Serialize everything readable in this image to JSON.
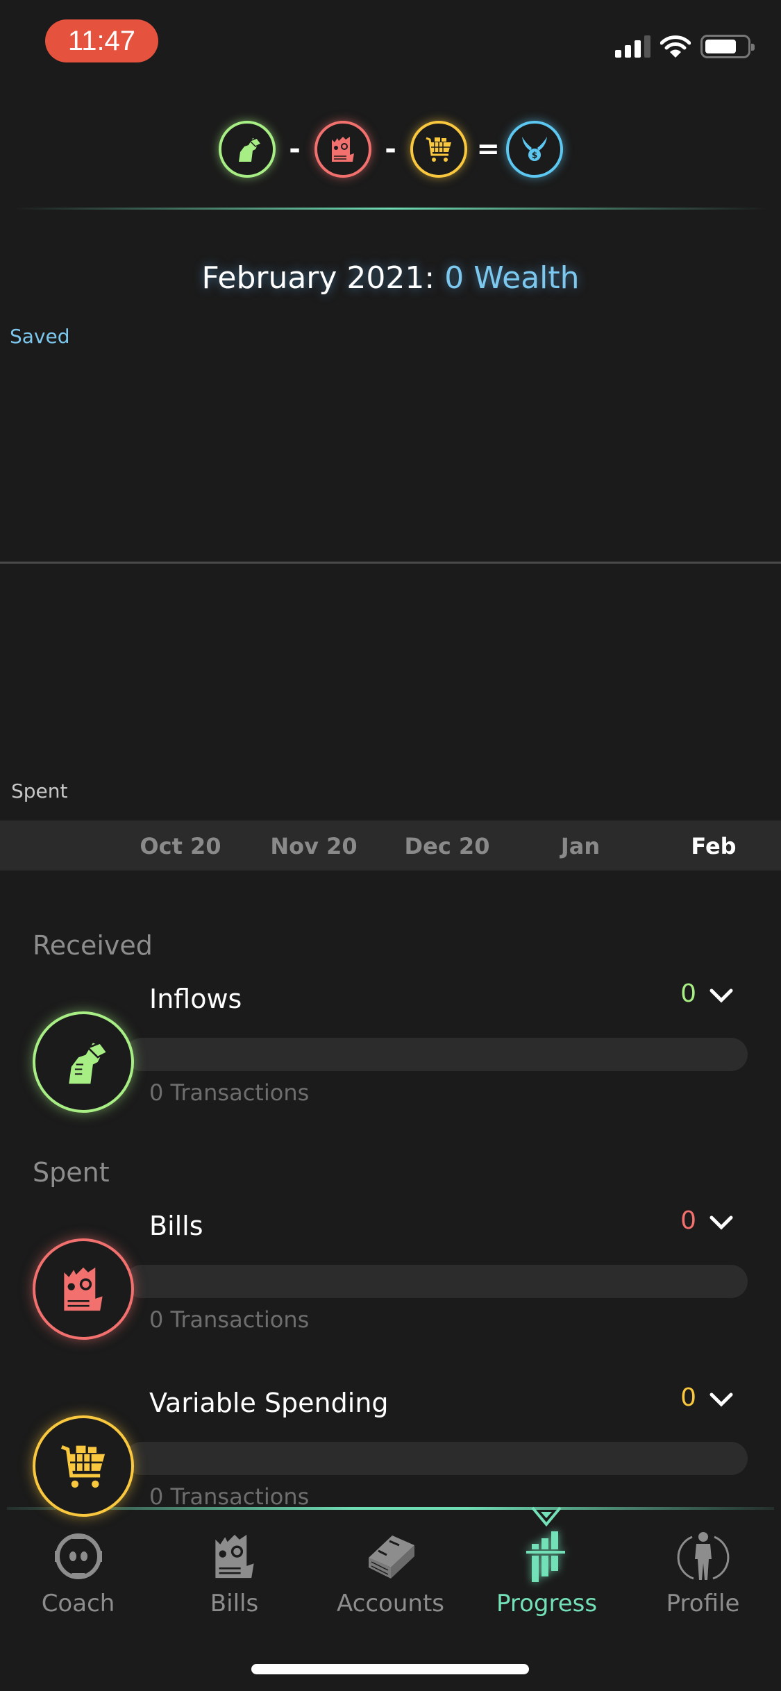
{
  "status_bar": {
    "time": "11:47",
    "signal_bars": 3,
    "signal_bars_total": 4,
    "battery_level": 0.75
  },
  "formula": {
    "items": [
      {
        "name": "inflows",
        "icon": "money-fist-icon",
        "color": "#a7ee84"
      },
      {
        "operator": "-"
      },
      {
        "name": "bills",
        "icon": "bill-receipt-icon",
        "color": "#f2706d"
      },
      {
        "operator": "-"
      },
      {
        "name": "variable-spending",
        "icon": "shopping-cart-icon",
        "color": "#f9c83e"
      },
      {
        "operator": "="
      },
      {
        "name": "wealth",
        "icon": "winged-coin-icon",
        "color": "#5cc8f2"
      }
    ]
  },
  "header": {
    "title_prefix": "February 2021: ",
    "title_value": "0 Wealth"
  },
  "chart": {
    "saved_label": "Saved",
    "spent_label": "Spent"
  },
  "chart_data": {
    "type": "bar",
    "title": "February 2021: 0 Wealth",
    "categories": [
      "Oct 20",
      "Nov 20",
      "Dec 20",
      "Jan",
      "Feb"
    ],
    "series": [
      {
        "name": "Saved",
        "values": [
          0,
          0,
          0,
          0,
          0
        ]
      },
      {
        "name": "Spent",
        "values": [
          0,
          0,
          0,
          0,
          0
        ]
      }
    ],
    "selected": "Feb",
    "xlabel": "",
    "ylabel": ""
  },
  "months": [
    {
      "label": "Oct 20",
      "active": false
    },
    {
      "label": "Nov 20",
      "active": false
    },
    {
      "label": "Dec 20",
      "active": false
    },
    {
      "label": "Jan",
      "active": false
    },
    {
      "label": "Feb",
      "active": true
    }
  ],
  "sections": {
    "received": {
      "header": "Received",
      "items": [
        {
          "name": "Inflows",
          "amount": "0",
          "transactions": "0 Transactions",
          "color": "#a7ee84",
          "progress": 0
        }
      ]
    },
    "spent": {
      "header": "Spent",
      "items": [
        {
          "name": "Bills",
          "amount": "0",
          "transactions": "0 Transactions",
          "color": "#f2706d",
          "progress": 0
        },
        {
          "name": "Variable Spending",
          "amount": "0",
          "transactions": "0 Transactions",
          "color": "#f9c83e",
          "progress": 0
        }
      ]
    }
  },
  "nav": {
    "items": [
      {
        "label": "Coach",
        "icon": "robot-helmet-icon",
        "active": false
      },
      {
        "label": "Bills",
        "icon": "bill-receipt-icon",
        "active": false
      },
      {
        "label": "Accounts",
        "icon": "cash-stack-icon",
        "active": false
      },
      {
        "label": "Progress",
        "icon": "progress-bars-icon",
        "active": true
      },
      {
        "label": "Profile",
        "icon": "person-icon",
        "active": false
      }
    ],
    "active_color": "#74e0b8",
    "inactive_color": "#8d8d8d"
  }
}
